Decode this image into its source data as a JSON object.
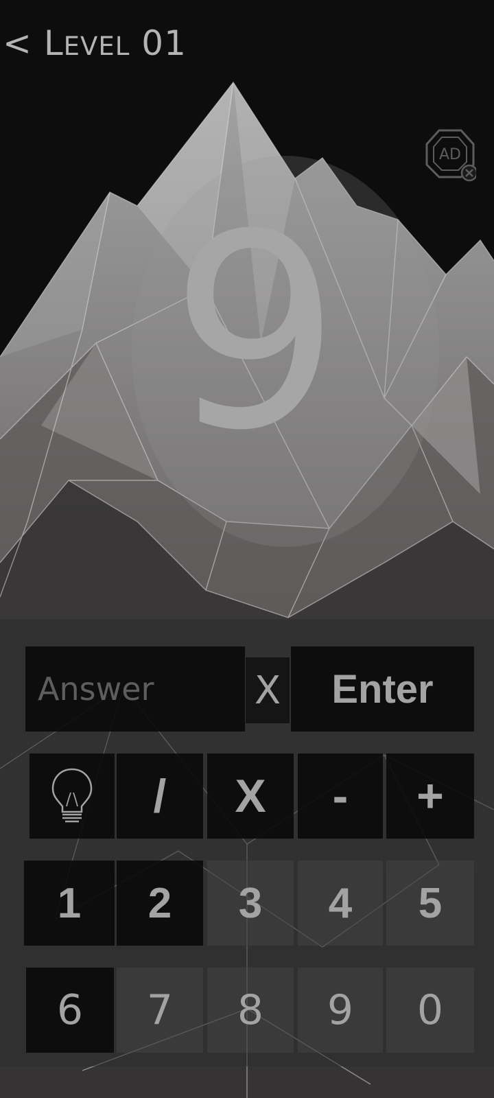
{
  "header": {
    "back_arrow": "<",
    "level_initial": "L",
    "level_rest": "EVEL",
    "level_number": "01"
  },
  "ad_button": {
    "label": "AD",
    "icon": "ad-close-icon"
  },
  "puzzle": {
    "target": "9"
  },
  "answer": {
    "placeholder": "Answer",
    "value": ""
  },
  "controls": {
    "clear_label": "X",
    "enter_label": "Enter",
    "hint_icon": "lightbulb-icon"
  },
  "operators": [
    "/",
    "X",
    "-",
    "+"
  ],
  "digits_row1": [
    "1",
    "2",
    "3",
    "4",
    "5"
  ],
  "digits_row2": [
    "6",
    "7",
    "8",
    "9",
    "0"
  ],
  "colors": {
    "background": "#0c0c0d",
    "text": "#a6a6a6"
  }
}
